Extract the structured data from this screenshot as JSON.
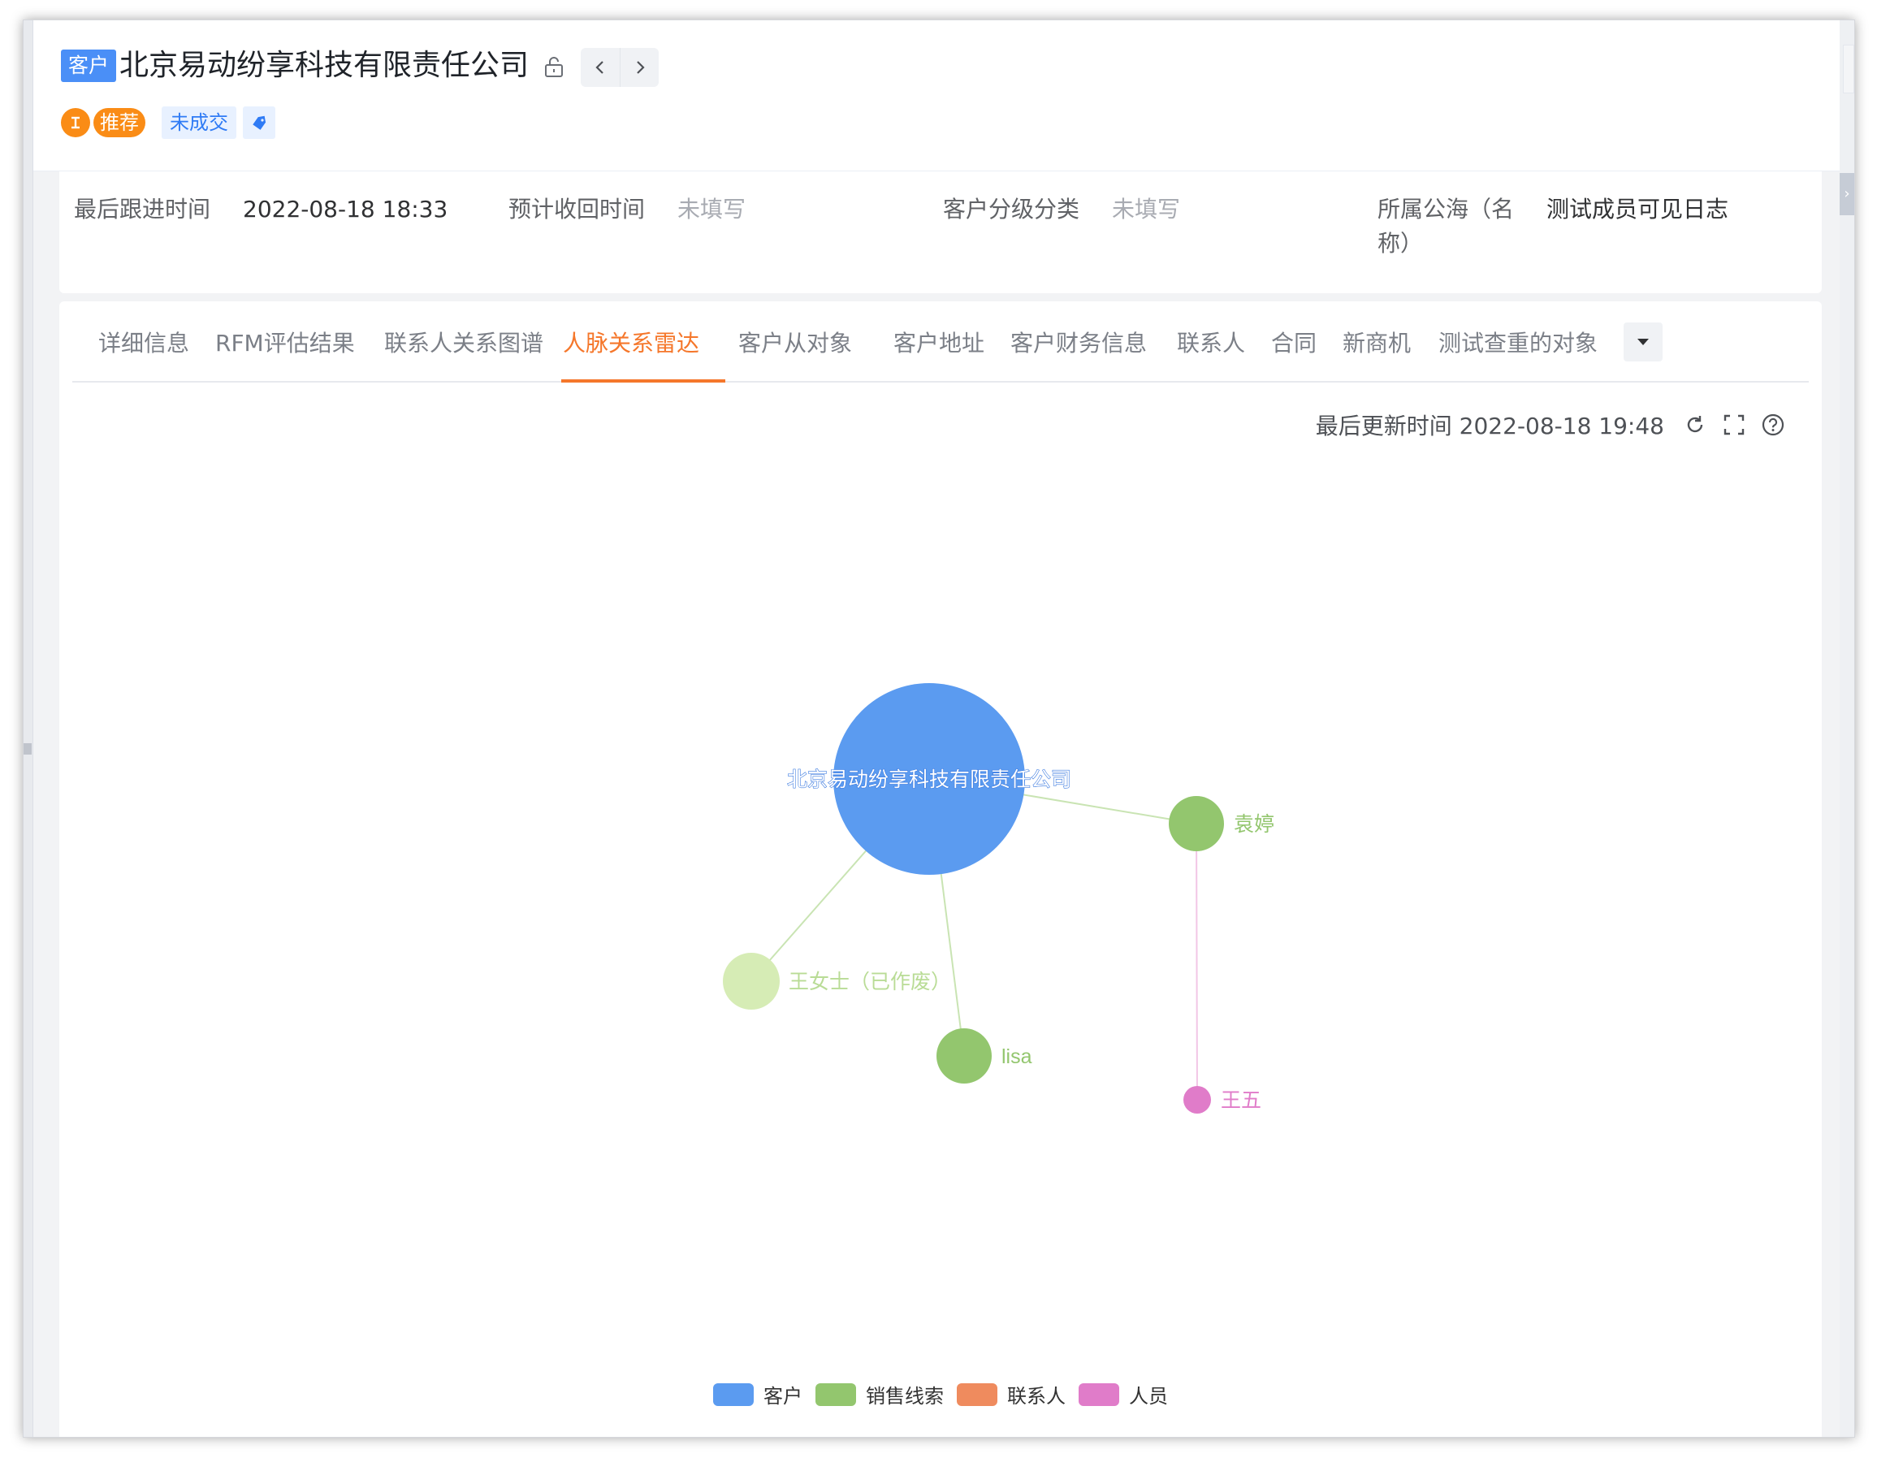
{
  "header": {
    "type_badge": "客户",
    "company_name": "北京易动纷享科技有限责任公司",
    "tags": {
      "circle": "I",
      "recommend": "推荐",
      "status": "未成交"
    }
  },
  "info": [
    {
      "label": "最后跟进时间",
      "value": "2022-08-18 18:33",
      "empty": false
    },
    {
      "label": "预计收回时间",
      "value": "未填写",
      "empty": true
    },
    {
      "label": "客户分级分类",
      "value": "未填写",
      "empty": true
    },
    {
      "label": "所属公海（名",
      "label2": "称）",
      "value": "测试成员可见日志",
      "empty": false
    }
  ],
  "tabs": [
    {
      "label": "详细信息",
      "active": false
    },
    {
      "label": "RFM评估结果",
      "active": false
    },
    {
      "label": "联系人关系图谱",
      "active": false
    },
    {
      "label": "人脉关系雷达",
      "active": true
    },
    {
      "label": "客户从对象",
      "active": false
    },
    {
      "label": "客户地址",
      "active": false
    },
    {
      "label": "客户财务信息",
      "active": false
    },
    {
      "label": "联系人",
      "active": false
    },
    {
      "label": "合同",
      "active": false
    },
    {
      "label": "新商机",
      "active": false
    },
    {
      "label": "测试查重的对象",
      "active": false
    }
  ],
  "toolbar": {
    "updated_label": "最后更新时间 2022-08-18 19:48"
  },
  "colors": {
    "customer": "#5b9bf0",
    "lead": "#93c66e",
    "lead_light": "#d6ecb5",
    "contact": "#ef8b5e",
    "person": "#e07cc9",
    "accent": "#f5772b",
    "brand_blue": "#4a8ff7"
  },
  "graph": {
    "nodes": [
      {
        "id": "company",
        "label": "北京易动纷享科技有限责任公司",
        "category": "客户"
      },
      {
        "id": "yuanting",
        "label": "袁婷",
        "category": "销售线索"
      },
      {
        "id": "wangnvshi",
        "label": "王女士（已作废）",
        "category": "销售线索"
      },
      {
        "id": "lisa",
        "label": "lisa",
        "category": "销售线索"
      },
      {
        "id": "wangwu",
        "label": "王五",
        "category": "人员"
      }
    ],
    "edges": [
      {
        "from": "company",
        "to": "yuanting"
      },
      {
        "from": "company",
        "to": "wangnvshi"
      },
      {
        "from": "company",
        "to": "lisa"
      },
      {
        "from": "yuanting",
        "to": "wangwu"
      }
    ]
  },
  "legend": [
    {
      "label": "客户",
      "color": "#5b9bf0"
    },
    {
      "label": "销售线索",
      "color": "#93c66e"
    },
    {
      "label": "联系人",
      "color": "#ef8b5e"
    },
    {
      "label": "人员",
      "color": "#e07cc9"
    }
  ]
}
